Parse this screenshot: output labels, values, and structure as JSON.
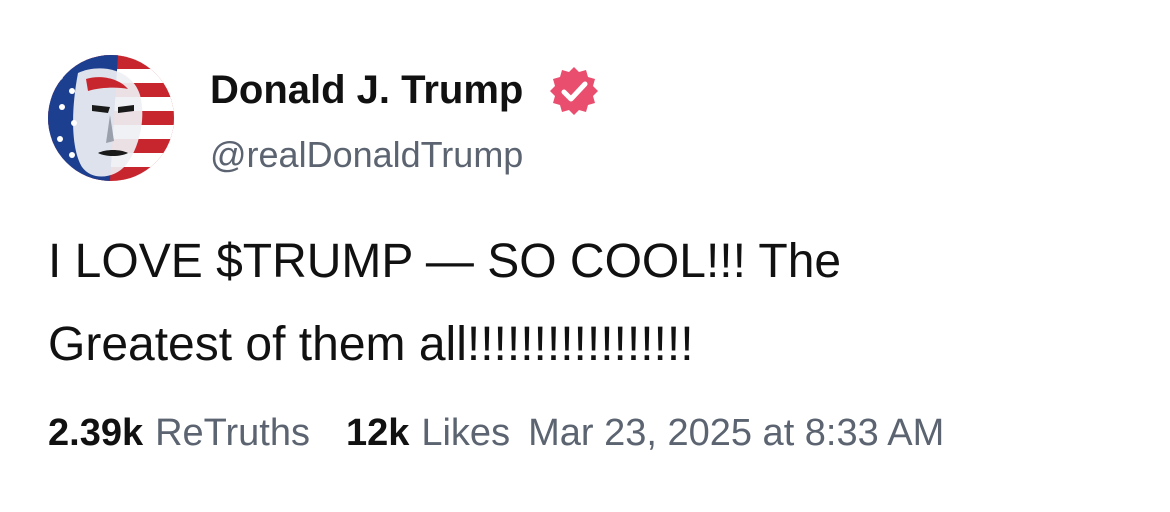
{
  "author": {
    "display_name": "Donald J. Trump",
    "handle": "@realDonaldTrump",
    "verified": true,
    "verified_badge_color": "#e94e6e"
  },
  "post": {
    "body_lines": [
      "I LOVE $TRUMP — SO COOL!!! The",
      "Greatest of them all!!!!!!!!!!!!!!!!!"
    ]
  },
  "stats": {
    "retruths_count": "2.39k",
    "retruths_label": "ReTruths",
    "likes_count": "12k",
    "likes_label": "Likes",
    "timestamp": "Mar 23, 2025 at 8:33 AM"
  },
  "icons": {
    "avatar": "flag-portrait-avatar",
    "badge": "verified-check-icon"
  }
}
